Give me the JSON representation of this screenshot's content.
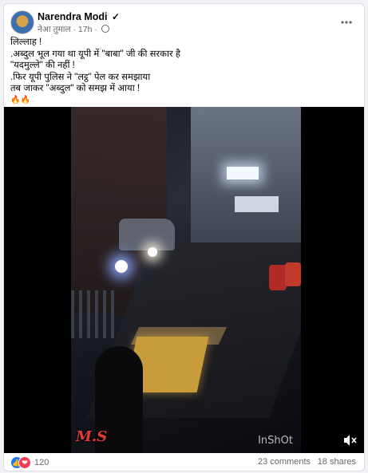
{
  "post": {
    "author": "Narendra Modi",
    "verified_mark": "✓",
    "group": "नेआ तुमाल",
    "time": "17h",
    "separator": "·",
    "menu_icon": "more-horizontal-icon",
    "text_lines": [
      "लिल्लाह !",
      ".अब्दुल भूल गया था यूपी में \"बाबा\" जी की सरकार है",
      "\"यदमुल्ले\" की नहीं !",
      ".फिर यूपी पुलिस ने \"लट्ठ\" पेल कर समझाया",
      "तब जाकर \"अब्दुल\" को समझ में आया !"
    ],
    "fire_emojis": "🔥🔥"
  },
  "video": {
    "watermark_left": "M.S",
    "watermark_right": "InShOt",
    "volume_icon": "volume-muted-icon"
  },
  "footer": {
    "reaction_icons": [
      "like-icon",
      "love-icon"
    ],
    "like_glyph": "👍",
    "love_glyph": "❤",
    "reaction_count": "120",
    "comments": "23 comments",
    "shares": "18 shares"
  },
  "colors": {
    "facebook_blue": "#1877f2",
    "love_red": "#f33e58",
    "watermark_red": "#e53935"
  }
}
